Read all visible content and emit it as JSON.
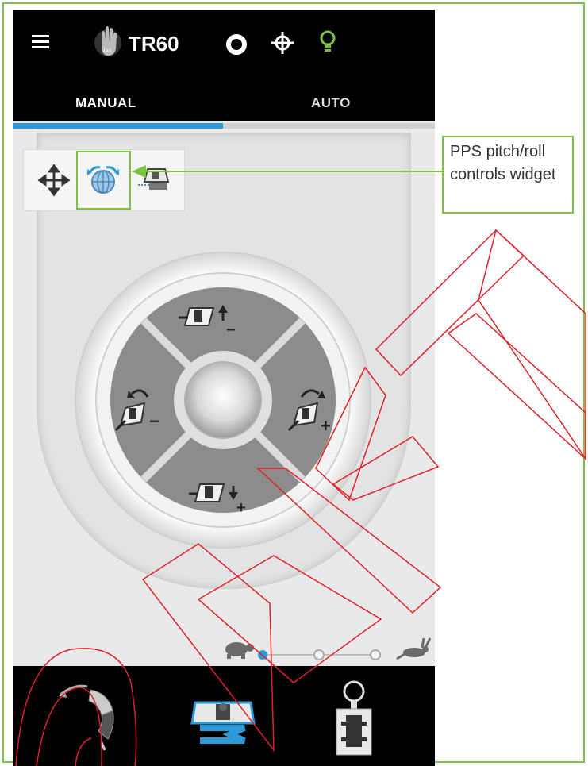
{
  "header": {
    "title": "TR60",
    "icons": [
      "menu-icon",
      "iba-logo",
      "ring-icon",
      "crosshair-icon",
      "bulb-icon"
    ]
  },
  "tabs": [
    {
      "label": "MANUAL",
      "active": true
    },
    {
      "label": "AUTO",
      "active": false
    }
  ],
  "toolbar": {
    "tools": [
      "move-icon",
      "pitch-roll-icon",
      "couch-table-icon"
    ],
    "selected": "pitch-roll-icon"
  },
  "callout": {
    "text": "PPS pitch/roll controls widget"
  },
  "dial": {
    "segments": [
      "pitch-plus",
      "roll-minus",
      "roll-plus",
      "pitch-minus"
    ],
    "minus": "−",
    "plus": "+"
  },
  "speed": {
    "levels": 3,
    "selected_index": 0,
    "icons": [
      "turtle-icon",
      "rabbit-icon"
    ]
  },
  "bottom_nav": {
    "items": [
      "gantry-arc-icon",
      "couch-icon",
      "gantry-head-icon"
    ]
  },
  "colors": {
    "accent_blue": "#2b9ad6",
    "callout_green": "#7dc242",
    "annotation_red": "#e0202a",
    "segment_gray": "#8c8c8c"
  }
}
